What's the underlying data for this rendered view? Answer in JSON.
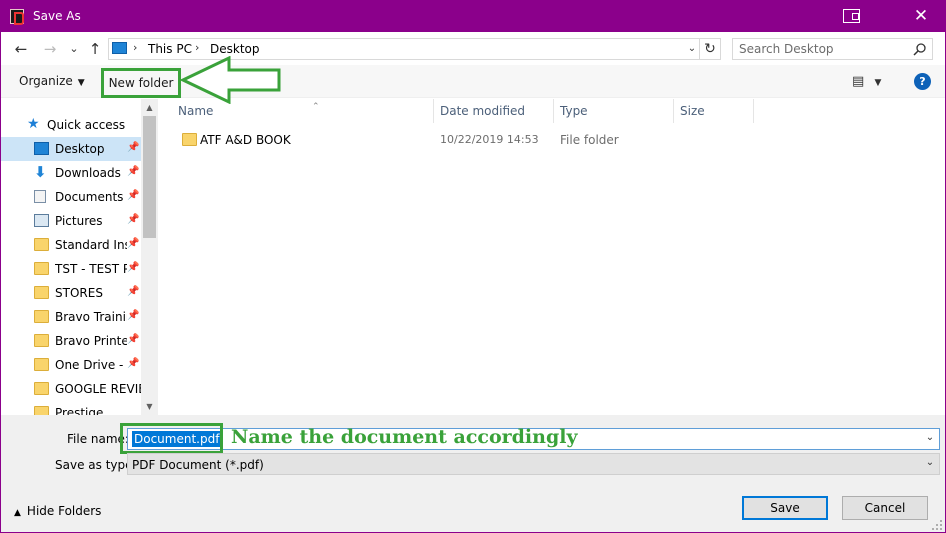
{
  "titlebar": {
    "title": "Save As"
  },
  "nav": {
    "back": "←",
    "forward": "→",
    "recent": "⌄",
    "up": "↑"
  },
  "address": {
    "parts": [
      "This PC",
      "Desktop"
    ],
    "separator": "›"
  },
  "search": {
    "placeholder": "Search Desktop"
  },
  "commandbar": {
    "organize": "Organize",
    "new_folder": "New folder"
  },
  "navpane": {
    "quick_access": "Quick access",
    "items": [
      {
        "label": "Desktop",
        "icon": "desktop-icon",
        "selected": true
      },
      {
        "label": "Downloads",
        "icon": "download-icon"
      },
      {
        "label": "Documents",
        "icon": "documents-icon"
      },
      {
        "label": "Pictures",
        "icon": "pictures-icon"
      },
      {
        "label": "Standard Inst",
        "icon": "folder-icon"
      },
      {
        "label": "TST - TEST PR",
        "icon": "folder-icon"
      },
      {
        "label": "STORES",
        "icon": "folder-icon"
      },
      {
        "label": "Bravo Training",
        "icon": "folder-icon"
      },
      {
        "label": "Bravo Printer",
        "icon": "folder-icon"
      },
      {
        "label": "One Drive - IN",
        "icon": "folder-icon"
      },
      {
        "label": "GOOGLE REVIEW",
        "icon": "folder-icon"
      },
      {
        "label": "Prestige",
        "icon": "folder-icon"
      }
    ]
  },
  "filelist": {
    "columns": [
      "Name",
      "Date modified",
      "Type",
      "Size"
    ],
    "rows": [
      {
        "name": "ATF A&D BOOK",
        "date": "10/22/2019 14:53",
        "type": "File folder",
        "size": ""
      }
    ]
  },
  "bottom": {
    "filename_label": "File name:",
    "filename_value": "Document.pdf",
    "annotation": "Name the document accordingly",
    "savetype_label": "Save as type:",
    "savetype_value": "PDF Document (*.pdf)",
    "hide_folders": "Hide Folders",
    "save": "Save",
    "cancel": "Cancel"
  },
  "colors": {
    "titlebar": "#8b008b",
    "annotation_green": "#3aa23a",
    "selection_blue": "#0078d7",
    "nav_selected": "#cce4f7"
  }
}
